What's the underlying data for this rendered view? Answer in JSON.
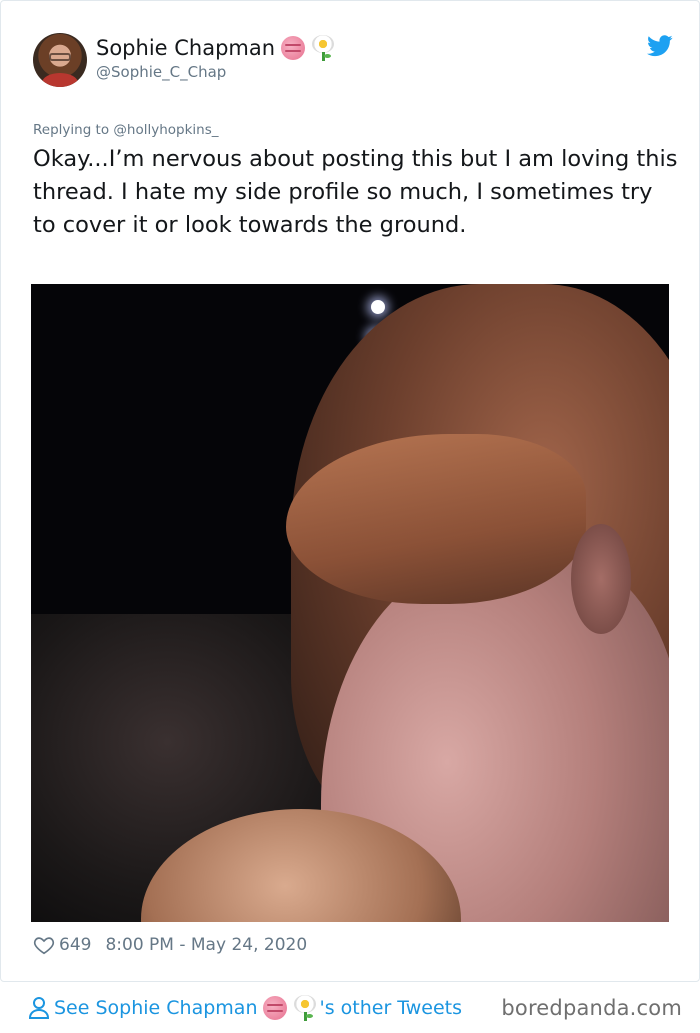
{
  "tweet": {
    "author": {
      "display_name": "Sophie Chapman",
      "handle": "@Sophie_C_Chap",
      "name_emojis": [
        "brain-emoji",
        "blossom-emoji"
      ]
    },
    "replying_to": "Replying to @hollyhopkins_",
    "text": "Okay...I’m nervous about posting this but I am loving this thread. I hate my side profile so much, I sometimes try to cover it or look towards the ground.",
    "likes": "649",
    "timestamp": "8:00 PM - May 24, 2020",
    "brand_icon": "twitter-bird-icon",
    "brand_color": "#1da1f2"
  },
  "footer": {
    "see_other_prefix": "See Sophie Chapman",
    "see_other_suffix": "'s other Tweets",
    "link_color": "#1b95e0",
    "watermark": "boredpanda.com"
  }
}
